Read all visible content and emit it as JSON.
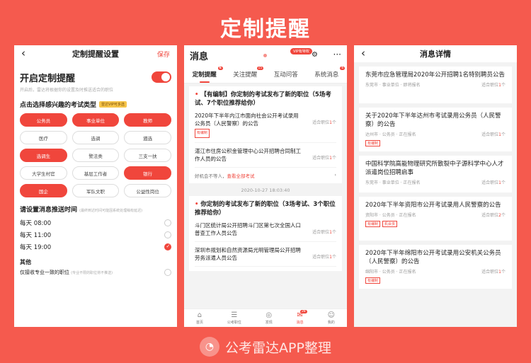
{
  "title": "定制提醒",
  "footer": {
    "text": "公考雷达APP整理"
  },
  "phone1": {
    "nav_title": "定制提醒设置",
    "save": "保存",
    "toggle_title": "开启定制提醒",
    "toggle_sub": "开启后，雷达将根据你的设置及时推送适合的职位",
    "exam_type_title": "点击选择感兴趣的考试类型",
    "vip_tag": "雷达VIP可多选",
    "chips": [
      {
        "label": "公务员",
        "on": true
      },
      {
        "label": "事业单位",
        "on": true
      },
      {
        "label": "教师",
        "on": true
      },
      {
        "label": "医疗",
        "on": false
      },
      {
        "label": "选调",
        "on": false
      },
      {
        "label": "遴选",
        "on": false
      },
      {
        "label": "选调生",
        "on": true
      },
      {
        "label": "警法类",
        "on": false
      },
      {
        "label": "三支一扶",
        "on": false
      },
      {
        "label": "大学生村官",
        "on": false
      },
      {
        "label": "基层工作者",
        "on": false
      },
      {
        "label": "银行",
        "on": true
      },
      {
        "label": "国企",
        "on": true
      },
      {
        "label": "军队文职",
        "on": false
      },
      {
        "label": "公益性岗位",
        "on": false
      }
    ],
    "time_title": "请设置消息推送时间",
    "time_note": "(最终到达时间可能因系统处理稍有延迟)",
    "times": [
      {
        "label": "每天 08:00",
        "on": false
      },
      {
        "label": "每天 11:00",
        "on": false
      },
      {
        "label": "每天 19:00",
        "on": true
      }
    ],
    "other_title": "其他",
    "other_label": "仅接收专业一致的职位",
    "other_note": "(专业不限的职位将不推送)"
  },
  "phone2": {
    "title": "消息",
    "vip": "VIP有特权",
    "tabs": [
      {
        "label": "定制提醒",
        "badge": "6",
        "on": true
      },
      {
        "label": "关注提醒",
        "badge": "15",
        "on": false
      },
      {
        "label": "互动问答",
        "badge": "",
        "on": false
      },
      {
        "label": "系统消息",
        "badge": "6",
        "on": false
      }
    ],
    "card1": {
      "prefix": "【有编制】",
      "heading": "你定制的考试发布了新的职位（5场考试、7个职位推荐给你）",
      "jobs": [
        {
          "title": "2020年下半年内江市面向社会公开考试录用公务员（人民警察）的公告",
          "tag": "有编制",
          "fit_label": "适合职位",
          "fit_count": "1",
          "unit": "个"
        },
        {
          "title": "湛江市住房公积金管理中心公开招聘合同制工作人员的公告",
          "tag": "",
          "fit_label": "适合职位",
          "fit_count": "1",
          "unit": "个"
        }
      ],
      "foot_text": "好机会不等人，",
      "foot_link": "查看全部考试"
    },
    "stamp": "2020-10-27 18:03:40",
    "card2": {
      "heading": "你定制的考试发布了新的职位（3场考试、3个职位推荐给你）",
      "jobs": [
        {
          "title": "斗门区统计局公开招聘斗门区第七次全国人口普查工作人员公告",
          "fit_label": "适合职位",
          "fit_count": "1",
          "unit": "个"
        },
        {
          "title": "深圳市规划和自然资源局光明管理局公开招聘劳务派遣人员公告",
          "fit_label": "适合职位",
          "fit_count": "1",
          "unit": "个"
        }
      ]
    },
    "tabbar": [
      {
        "label": "首页",
        "icon": "home-icon",
        "glyph": "⌂",
        "on": false,
        "badge": ""
      },
      {
        "label": "公考职位",
        "icon": "list-icon",
        "glyph": "☰",
        "on": false,
        "badge": ""
      },
      {
        "label": "发现",
        "icon": "compass-icon",
        "glyph": "◎",
        "on": false,
        "badge": ""
      },
      {
        "label": "消息",
        "icon": "message-icon",
        "glyph": "✉",
        "on": true,
        "badge": "28"
      },
      {
        "label": "我的",
        "icon": "user-icon",
        "glyph": "☺",
        "on": false,
        "badge": ""
      }
    ]
  },
  "phone3": {
    "nav_title": "消息详情",
    "items": [
      {
        "title": "东莞市应急管理局2020年公开招聘1名特别聘员公告",
        "meta": "东莞市 · 事业单位 · 即将报名",
        "fit_label": "适合职位",
        "fit_count": "1",
        "unit": "个",
        "tags": []
      },
      {
        "title": "关于2020年下半年达州市考试录用公务员（人民警察）的公告",
        "meta": "达州市 · 公务员 · 正在报名",
        "fit_label": "适合职位",
        "fit_count": "1",
        "unit": "个",
        "tags": [
          "有编制"
        ]
      },
      {
        "title": "中国科学院高能物理研究所散裂中子源科学中心人才派遣岗位招聘启事",
        "meta": "东莞市 · 事业单位 · 正在报名",
        "fit_label": "适合职位",
        "fit_count": "1",
        "unit": "个",
        "tags": []
      },
      {
        "title": "2020年下半年资阳市公开考试录用人民警察的公告",
        "meta": "资阳市 · 公务员 · 正在报名",
        "fit_label": "适合职位",
        "fit_count": "2",
        "unit": "个",
        "tags": [
          "有编制",
          "机会多"
        ]
      },
      {
        "title": "2020年下半年绵阳市公开考试录用公安机关公务员（人民警察）的公告",
        "meta": "绵阳市 · 公务员 · 正在报名",
        "fit_label": "适合职位",
        "fit_count": "1",
        "unit": "个",
        "tags": [
          "有编制"
        ]
      }
    ]
  }
}
